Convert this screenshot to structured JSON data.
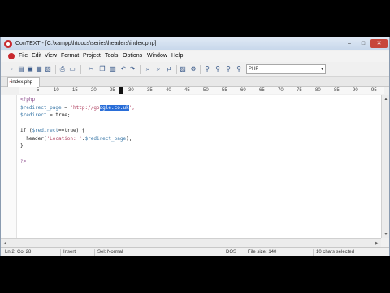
{
  "window": {
    "title": "ConTEXT - [C:\\xampp\\htdocs\\series\\headers\\index.php]",
    "controls": {
      "minimize": "–",
      "maximize": "□",
      "close": "✕"
    }
  },
  "menu": {
    "items": [
      "File",
      "Edit",
      "View",
      "Format",
      "Project",
      "Tools",
      "Options",
      "Window",
      "Help"
    ]
  },
  "toolbar": {
    "buttons": [
      "new-file",
      "open-file",
      "save",
      "save-all",
      "close",
      "print",
      "cut",
      "copy",
      "paste",
      "undo",
      "redo",
      "find",
      "find-next",
      "replace",
      "highlighter",
      "settings",
      "user-exec-1",
      "user-exec-2",
      "user-exec-3",
      "user-exec-4"
    ],
    "language": "PHP"
  },
  "tabs": [
    {
      "label": "index.php"
    }
  ],
  "ruler": {
    "labels": [
      "5",
      "10",
      "15",
      "20",
      "25",
      "30",
      "35",
      "40",
      "45",
      "50",
      "55",
      "60",
      "65",
      "70",
      "75",
      "80",
      "85",
      "90",
      "95"
    ]
  },
  "code": {
    "lines": [
      [
        {
          "t": "<?php",
          "c": "kw-php"
        }
      ],
      [
        {
          "t": "$redirect_page",
          "c": "var"
        },
        {
          "t": " = ",
          "c": "plain"
        },
        {
          "t": "'http://go",
          "c": "str"
        },
        {
          "t": "ogle.co.uk",
          "c": "sel"
        },
        {
          "t": "';",
          "c": "str"
        }
      ],
      [
        {
          "t": "$redirect",
          "c": "var"
        },
        {
          "t": " = ",
          "c": "plain"
        },
        {
          "t": "true",
          "c": "kw"
        },
        {
          "t": ";",
          "c": "plain"
        }
      ],
      [],
      [
        {
          "t": "if (",
          "c": "plain"
        },
        {
          "t": "$redirect",
          "c": "var"
        },
        {
          "t": "==",
          "c": "plain"
        },
        {
          "t": "true",
          "c": "kw"
        },
        {
          "t": ") {",
          "c": "plain"
        }
      ],
      [
        {
          "t": "  header(",
          "c": "plain"
        },
        {
          "t": "'Location: '",
          "c": "str"
        },
        {
          "t": ".",
          "c": "plain"
        },
        {
          "t": "$redirect_page",
          "c": "var"
        },
        {
          "t": ");",
          "c": "plain"
        }
      ],
      [
        {
          "t": "}",
          "c": "plain"
        }
      ],
      [],
      [
        {
          "t": "?>",
          "c": "kw-php"
        }
      ]
    ]
  },
  "status": {
    "position": "Ln 2, Col 28",
    "mode": "Insert",
    "selection": "Sel: Normal",
    "line_ending": "DOS",
    "file_size": "File size: 140",
    "selected": "10 chars selected"
  }
}
